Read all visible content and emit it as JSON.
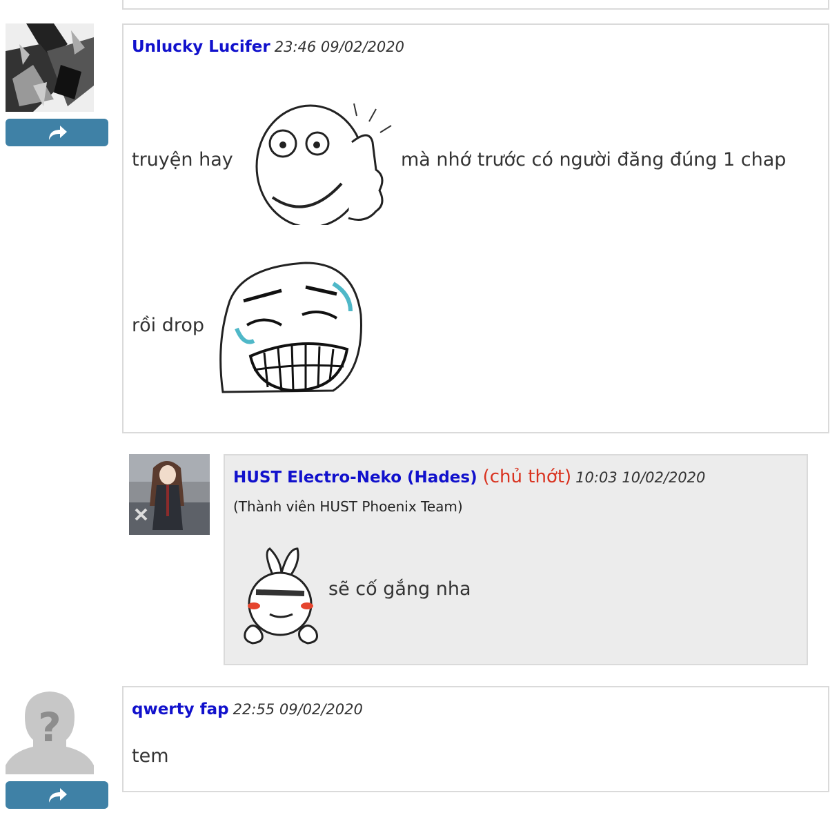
{
  "comments": [
    {
      "author": "Unlucky Lucifer",
      "time": "23:46 09/02/2020",
      "line1_before": "truyện hay",
      "line1_after": "mà nhớ trước có người đăng đúng 1 chap",
      "line2": "rồi drop",
      "emoji1": "thumbs-up-rage-face",
      "emoji2": "laughing-rage-face",
      "reply": {
        "author": "HUST Electro-Neko (Hades)",
        "owner_tag": "(chủ thớt)",
        "time": "10:03 10/02/2020",
        "member_note": "(Thành viên HUST Phoenix Team)",
        "text": "sẽ cố gắng nha",
        "emoji": "bunny-peace-emoticon"
      }
    },
    {
      "author": "qwerty fap",
      "time": "22:55 09/02/2020",
      "text": "tem"
    }
  ],
  "icons": {
    "reply": "share-arrow-icon",
    "default_avatar": "unknown-user-icon"
  },
  "colors": {
    "author": "#1111cc",
    "owner": "#d9321f",
    "reply_button": "#3f81a6",
    "reply_bg": "#ececec"
  }
}
